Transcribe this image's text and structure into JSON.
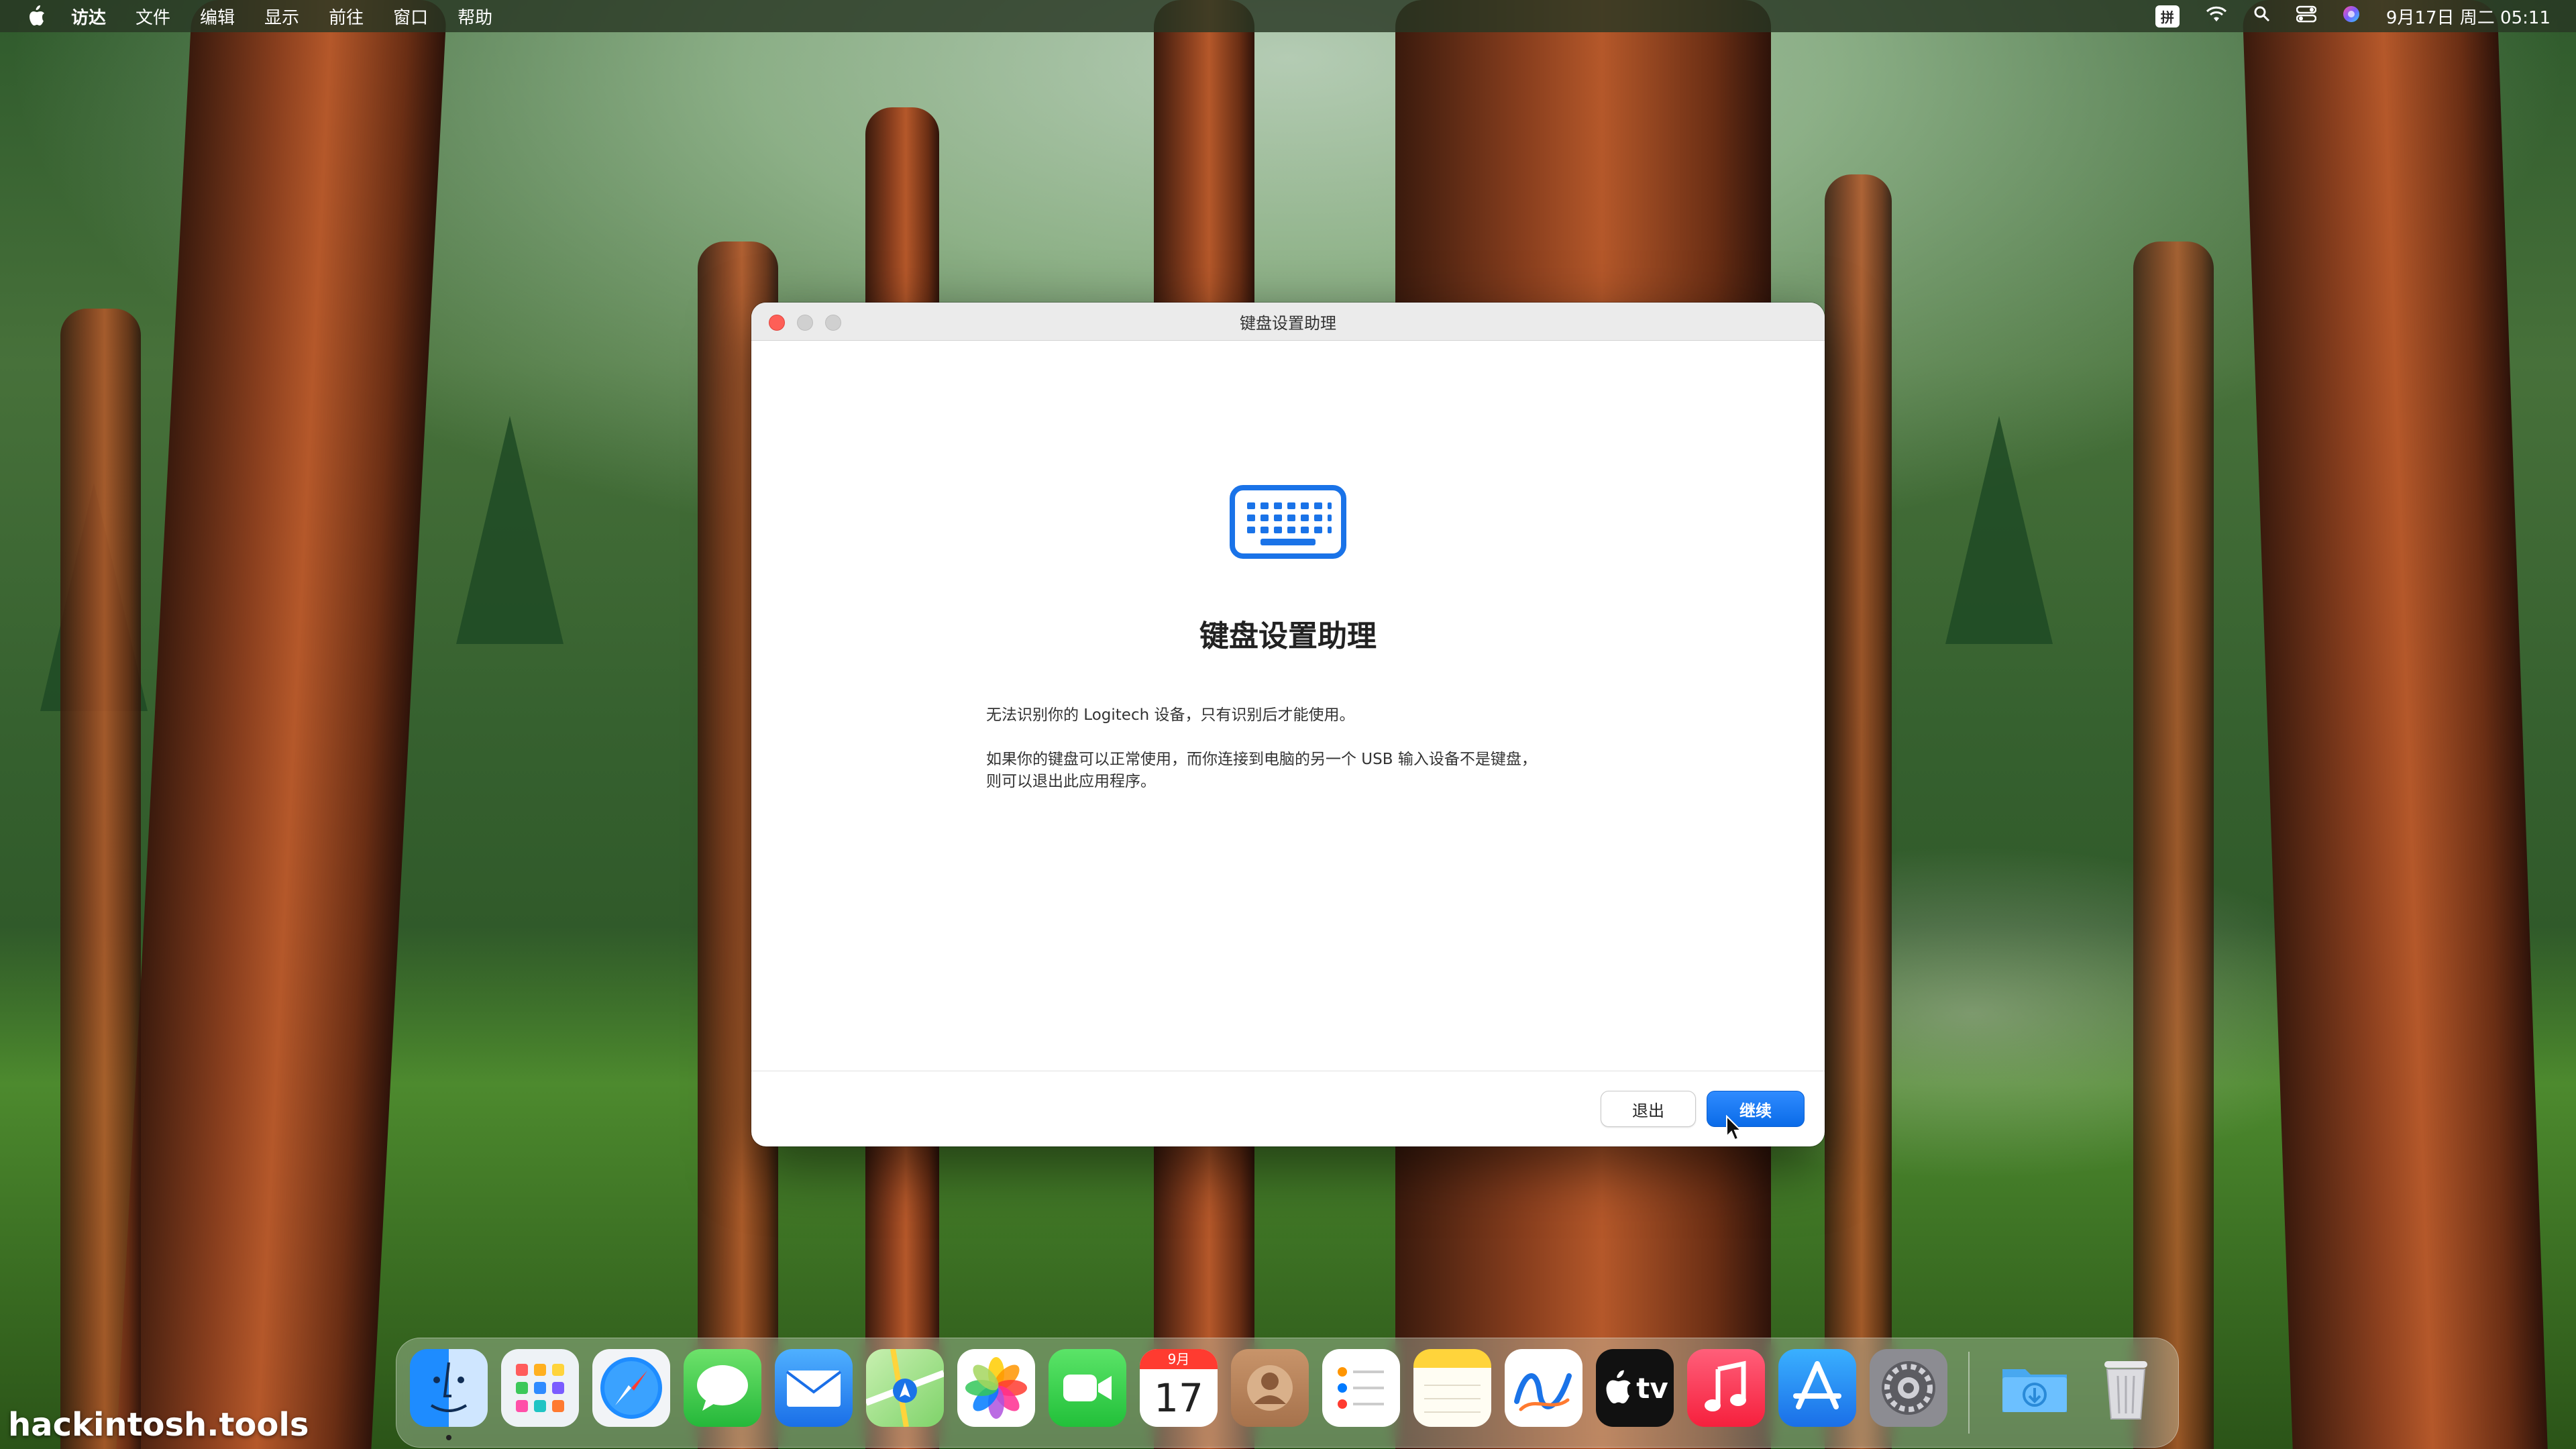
{
  "menubar": {
    "apple_icon": "apple-logo-icon",
    "items": [
      "访达",
      "文件",
      "编辑",
      "显示",
      "前往",
      "窗口",
      "帮助"
    ],
    "ime": "拼",
    "status_icons": [
      "wifi-icon",
      "search-icon",
      "control-center-icon",
      "siri-icon"
    ],
    "clock": "9月17日 周二  05:11"
  },
  "window": {
    "title": "键盘设置助理",
    "icon": "keyboard-icon",
    "heading": "键盘设置助理",
    "paragraph1": "无法识别你的 Logitech 设备，只有识别后才能使用。",
    "paragraph2_line1": "如果你的键盘可以正常使用，而你连接到电脑的另一个 USB 输入设备不是键盘，",
    "paragraph2_line2": "则可以退出此应用程序。",
    "buttons": {
      "quit": "退出",
      "continue": "继续"
    }
  },
  "dock": {
    "apps": [
      {
        "name": "Finder",
        "icon": "finder-icon"
      },
      {
        "name": "Launchpad",
        "icon": "launchpad-icon"
      },
      {
        "name": "Safari",
        "icon": "safari-icon"
      },
      {
        "name": "Messages",
        "icon": "messages-icon"
      },
      {
        "name": "Mail",
        "icon": "mail-icon"
      },
      {
        "name": "Maps",
        "icon": "maps-icon"
      },
      {
        "name": "Photos",
        "icon": "photos-icon"
      },
      {
        "name": "FaceTime",
        "icon": "facetime-icon"
      },
      {
        "name": "Calendar",
        "icon": "calendar-icon",
        "month": "9月",
        "day": "17"
      },
      {
        "name": "Contacts",
        "icon": "contacts-icon"
      },
      {
        "name": "Reminders",
        "icon": "reminders-icon"
      },
      {
        "name": "Notes",
        "icon": "notes-icon"
      },
      {
        "name": "Freeform",
        "icon": "freeform-icon"
      },
      {
        "name": "TV",
        "icon": "apple-tv-icon",
        "label": "tv"
      },
      {
        "name": "Music",
        "icon": "music-icon"
      },
      {
        "name": "App Store",
        "icon": "app-store-icon"
      },
      {
        "name": "System Settings",
        "icon": "system-settings-icon"
      },
      {
        "name": "Downloads",
        "icon": "downloads-folder-icon"
      },
      {
        "name": "Trash",
        "icon": "trash-icon"
      }
    ]
  },
  "watermark": "hackintosh.tools",
  "colors": {
    "accent": "#0a6be8",
    "close": "#fe5f57",
    "keyboard_icon": "#1a73e8"
  }
}
